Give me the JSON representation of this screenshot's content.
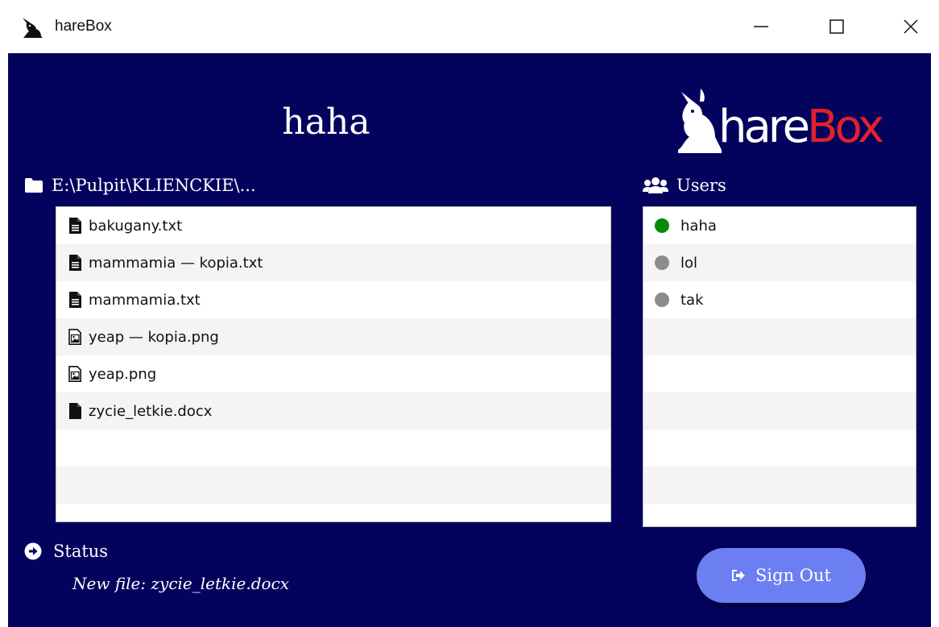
{
  "window": {
    "title": "hareBox",
    "controls": {
      "minimize": "minimize-icon",
      "maximize": "maximize-icon",
      "close": "close-icon"
    }
  },
  "header": {
    "username": "haha",
    "logo": {
      "text_white": "hare",
      "text_red": "Box"
    }
  },
  "files": {
    "path": "E:\\Pulpit\\KLIENCKIE\\...",
    "path_icon": "folder-icon",
    "items": [
      {
        "name": "bakugany.txt",
        "icon": "text-file-icon"
      },
      {
        "name": "mammamia — kopia.txt",
        "icon": "text-file-icon"
      },
      {
        "name": "mammamia.txt",
        "icon": "text-file-icon"
      },
      {
        "name": "yeap — kopia.png",
        "icon": "image-file-icon"
      },
      {
        "name": "yeap.png",
        "icon": "image-file-icon"
      },
      {
        "name": "zycie_letkie.docx",
        "icon": "file-icon"
      },
      {
        "name": "",
        "icon": ""
      },
      {
        "name": "",
        "icon": ""
      }
    ]
  },
  "users": {
    "label": "Users",
    "label_icon": "users-icon",
    "items": [
      {
        "name": "haha",
        "status": "online",
        "color": "#0a8a0a"
      },
      {
        "name": "lol",
        "status": "offline",
        "color": "#8c8c8c"
      },
      {
        "name": "tak",
        "status": "offline",
        "color": "#8c8c8c"
      },
      {
        "name": "",
        "status": "",
        "color": ""
      },
      {
        "name": "",
        "status": "",
        "color": ""
      },
      {
        "name": "",
        "status": "",
        "color": ""
      },
      {
        "name": "",
        "status": "",
        "color": ""
      },
      {
        "name": "",
        "status": "",
        "color": ""
      }
    ]
  },
  "status": {
    "label": "Status",
    "label_icon": "arrow-circle-right-icon",
    "text": "New file: zycie_letkie.docx"
  },
  "signout": {
    "label": "Sign Out",
    "icon": "sign-out-icon"
  },
  "colors": {
    "background": "#03035e",
    "accent_button": "#6c7ff2",
    "logo_red": "#e0222a"
  }
}
